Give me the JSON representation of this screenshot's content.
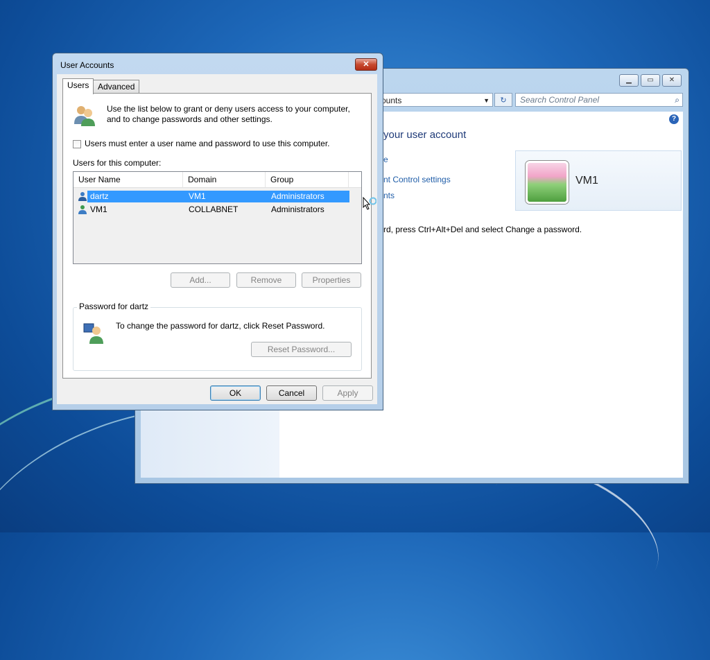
{
  "control_panel": {
    "address_text": "ounts",
    "search_placeholder": "Search Control Panel",
    "heading": "your user account",
    "links": [
      "e",
      "nt Control settings",
      "nts"
    ],
    "user_name": "VM1",
    "note": "rd, press Ctrl+Alt+Del and select Change a password."
  },
  "dialog": {
    "title": "User Accounts",
    "close_label": "✕",
    "tabs": [
      {
        "label": "Users",
        "active": true
      },
      {
        "label": "Advanced",
        "active": false
      }
    ],
    "intro": "Use the list below to grant or deny users access to your computer, and to change passwords and other settings.",
    "checkbox_label": "Users must enter a user name and password to use this computer.",
    "users_label": "Users for this computer:",
    "columns": [
      "User Name",
      "Domain",
      "Group"
    ],
    "rows": [
      {
        "name": "dartz",
        "domain": "VM1",
        "group": "Administrators",
        "selected": true
      },
      {
        "name": "VM1",
        "domain": "COLLABNET",
        "group": "Administrators",
        "selected": false
      }
    ],
    "buttons": {
      "add": "Add...",
      "remove": "Remove",
      "properties": "Properties"
    },
    "password_group": {
      "label": "Password for dartz",
      "text": "To change the password for dartz, click Reset Password.",
      "reset_button": "Reset Password..."
    },
    "footer": {
      "ok": "OK",
      "cancel": "Cancel",
      "apply": "Apply"
    }
  },
  "colors": {
    "selection": "#3399ff",
    "link": "#1f5da8",
    "heading": "#1e3a78"
  },
  "icons": [
    "users-icon",
    "user-icon",
    "password-user-icon",
    "close-icon",
    "search-icon",
    "help-icon",
    "refresh-icon",
    "busy-cursor-icon"
  ]
}
